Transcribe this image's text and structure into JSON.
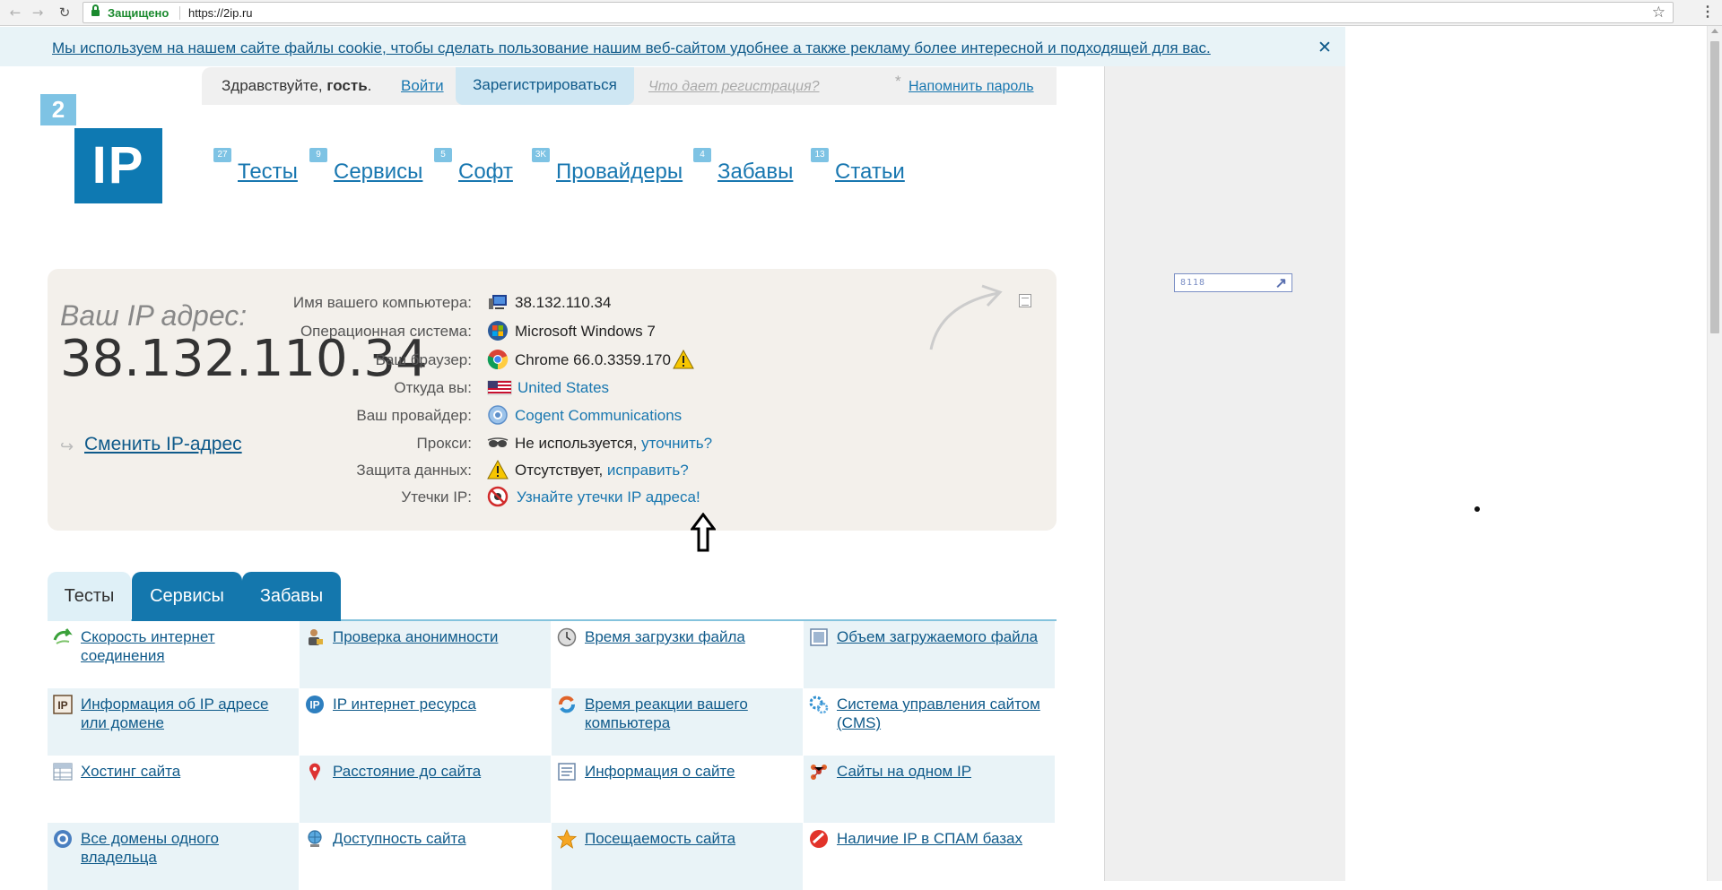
{
  "browser": {
    "secure_label": "Защищено",
    "url": "https://2ip.ru"
  },
  "cookie": {
    "text": "Мы используем на нашем сайте файлы cookie, чтобы сделать пользование нашим веб-сайтом удобнее а также рекламу более интересной и подходящей для вас.",
    "close": "✕"
  },
  "userbar": {
    "greeting_prefix": "Здравствуйте,",
    "greeting_user": "гость",
    "greeting_suffix": ".",
    "login": "Войти",
    "register": "Зарегистрироваться",
    "why_register": "Что дает регистрация?",
    "remind_star": "*",
    "remind": "Напомнить пароль"
  },
  "logo": {
    "top": "2",
    "main": "IP"
  },
  "nav": [
    {
      "badge": "27",
      "label": "Тесты"
    },
    {
      "badge": "9",
      "label": "Сервисы"
    },
    {
      "badge": "5",
      "label": "Софт"
    },
    {
      "badge": "3K",
      "label": "Провайдеры"
    },
    {
      "badge": "4",
      "label": "Забавы"
    },
    {
      "badge": "13",
      "label": "Статьи"
    }
  ],
  "ip_panel": {
    "label": "Ваш IP адрес:",
    "ip": "38.132.110.34",
    "change_ip": "Сменить IP-адрес",
    "rows": [
      {
        "label": "Имя вашего компьютера:",
        "icon": "computer-icon",
        "value": "38.132.110.34",
        "link": "",
        "extra": ""
      },
      {
        "label": "Операционная система:",
        "icon": "windows-icon",
        "value": "Microsoft Windows 7",
        "link": "",
        "extra": ""
      },
      {
        "label": "Ваш браузер:",
        "icon": "chrome-icon",
        "value": "Chrome 66.0.3359.170",
        "link": "",
        "extra": "warning"
      },
      {
        "label": "Откуда вы:",
        "icon": "us-flag-icon",
        "value": "",
        "link": "United States",
        "extra": ""
      },
      {
        "label": "Ваш провайдер:",
        "icon": "provider-icon",
        "value": "",
        "link": "Cogent Communications",
        "extra": ""
      },
      {
        "label": "Прокси:",
        "icon": "glasses-icon",
        "value": "Не используется,",
        "link": "уточнить?",
        "extra": ""
      },
      {
        "label": "Защита данных:",
        "icon": "warning-icon",
        "value": "Отсутствует,",
        "link": "исправить?",
        "extra": ""
      },
      {
        "label": "Утечки IP:",
        "icon": "leak-icon",
        "value": "",
        "link": "Узнайте утечки IP адреса!",
        "extra": ""
      }
    ]
  },
  "ad_widget": {
    "counter": "8118"
  },
  "tabs": [
    {
      "label": "Тесты",
      "active": true
    },
    {
      "label": "Сервисы",
      "active": false
    },
    {
      "label": "Забавы",
      "active": false
    }
  ],
  "tests": [
    [
      "Скорость интернет соединения",
      "Проверка анонимности",
      "Время загрузки файла",
      "Объем загружаемого файла"
    ],
    [
      "Информация об IP адресе или домене",
      "IP интернет ресурса",
      "Время реакции вашего компьютера",
      "Система управления сайтом (CMS)"
    ],
    [
      "Хостинг сайта",
      "Расстояние до сайта",
      "Информация о сайте",
      "Сайты на одном IP"
    ],
    [
      "Все домены одного владельца",
      "Доступность сайта",
      "Посещаемость сайта",
      "Наличие IP в СПАМ базах"
    ]
  ],
  "test_icons": [
    [
      "speed-icon",
      "anonymity-icon",
      "clock-icon",
      "file-size-icon"
    ],
    [
      "ip-info-icon",
      "ip-resource-icon",
      "reaction-icon",
      "cms-icon"
    ],
    [
      "hosting-icon",
      "distance-pin-icon",
      "site-info-icon",
      "same-ip-icon"
    ],
    [
      "domains-icon",
      "availability-icon",
      "star-icon",
      "spam-icon"
    ]
  ],
  "colors": {
    "accent": "#1477ad",
    "link": "#1877b0",
    "panel": "#f3f0eb",
    "secure": "#1a8a2e"
  }
}
